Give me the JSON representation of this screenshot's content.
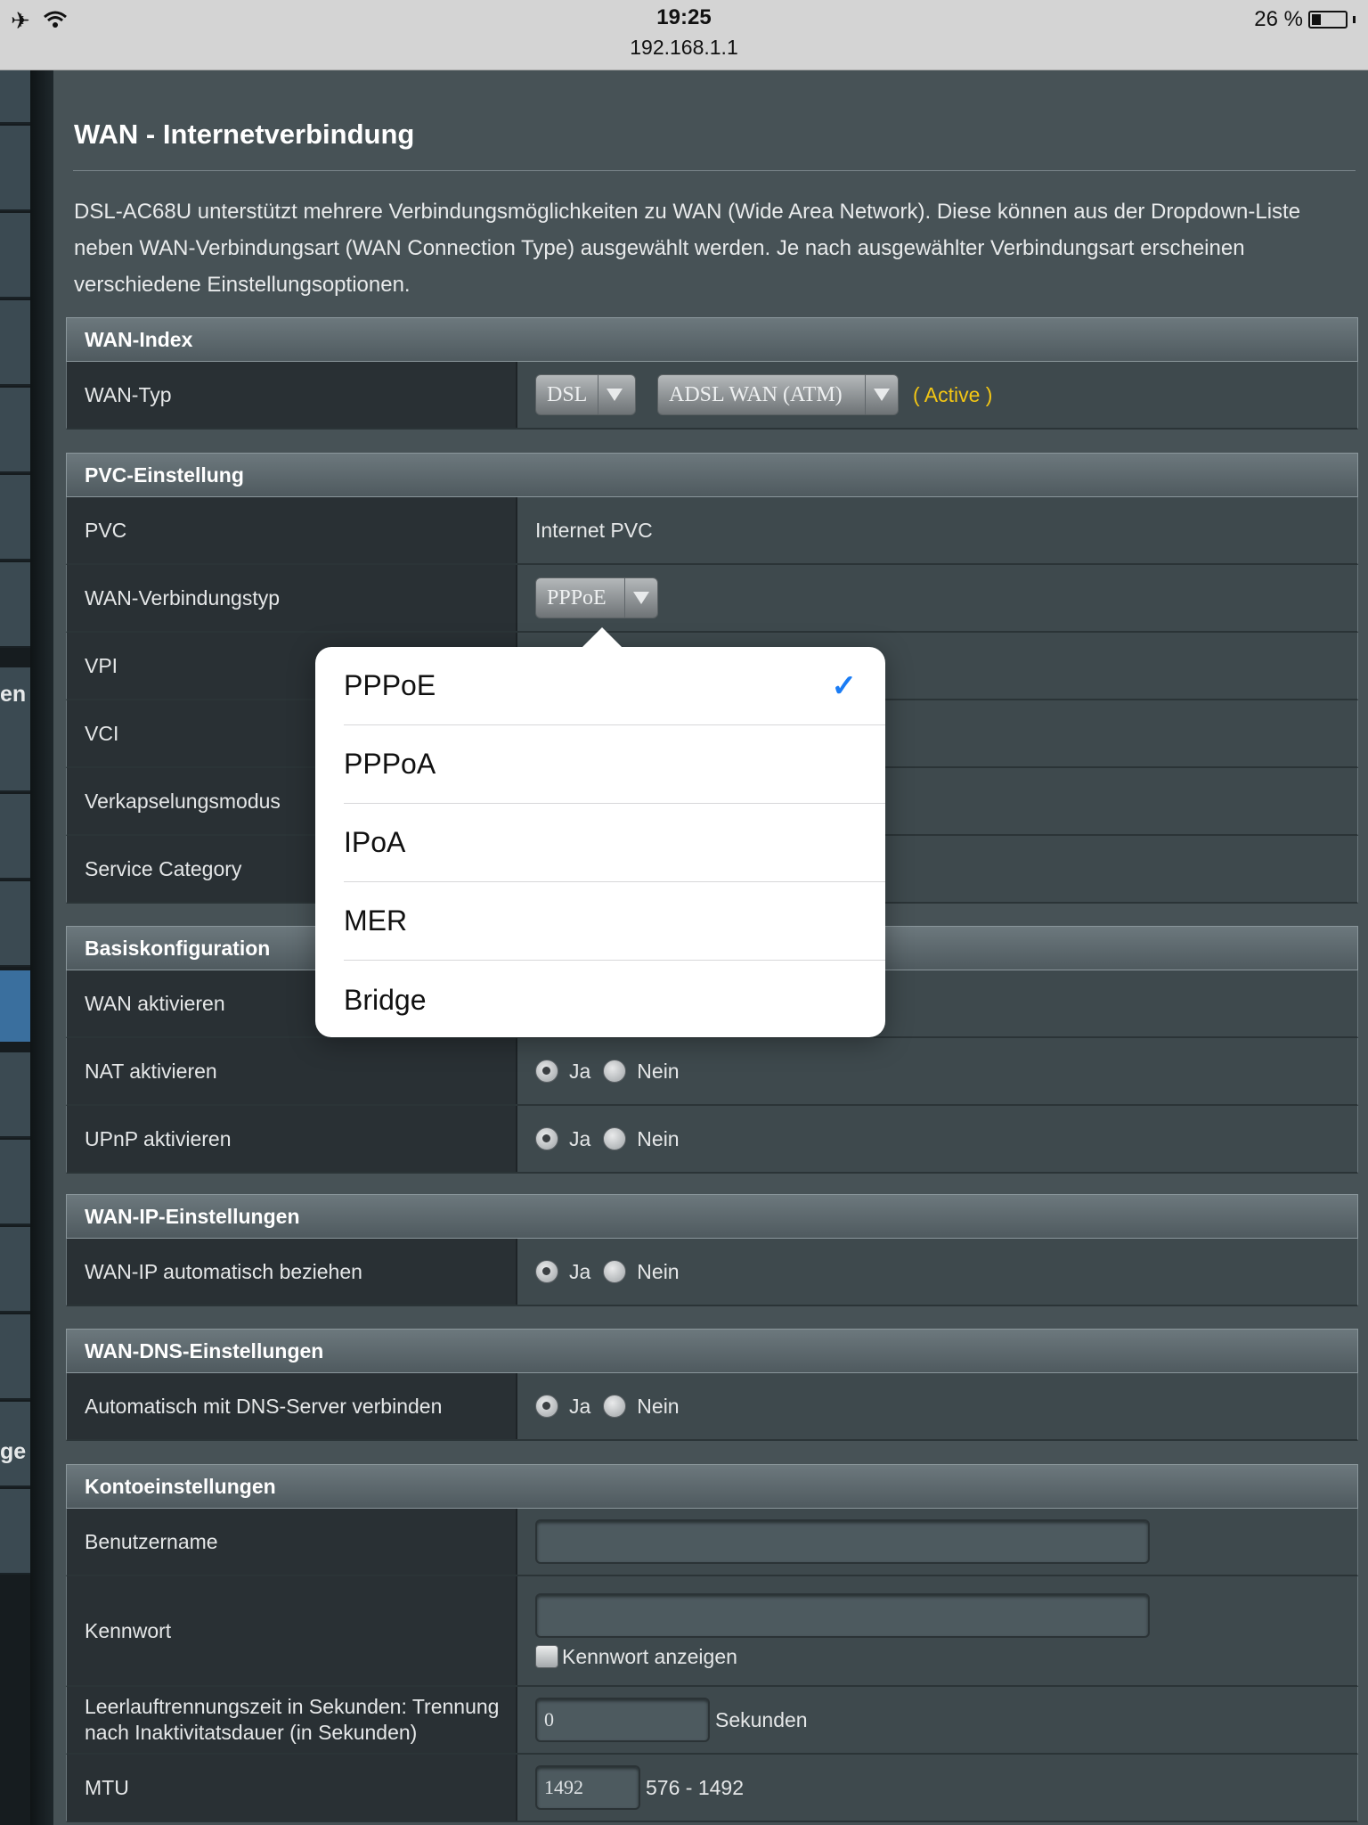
{
  "status": {
    "time": "19:25",
    "url": "192.168.1.1",
    "battery": "26 %"
  },
  "rail": {
    "label_1": "en",
    "label_2": "ge"
  },
  "page": {
    "title": "WAN - Internetverbindung",
    "description": "DSL-AC68U unterstützt mehrere Verbindungsmöglichkeiten zu WAN (Wide Area Network). Diese können aus der Dropdown-Liste neben WAN-Verbindungsart (WAN Connection Type) ausgewählt werden. Je nach ausgewählter Verbindungsart erscheinen verschiedene Einstellungsoptionen."
  },
  "wan_index": {
    "header": "WAN-Index",
    "wan_typ_label": "WAN-Typ",
    "wan_typ_value": "DSL",
    "wan_mode_value": "ADSL WAN (ATM)",
    "active_text": "( Active )"
  },
  "pvc": {
    "header": "PVC-Einstellung",
    "pvc_label": "PVC",
    "pvc_value": "Internet PVC",
    "conn_type_label": "WAN-Verbindungstyp",
    "conn_type_value": "PPPoE",
    "vpi_label": "VPI",
    "vci_label": "VCI",
    "encap_label": "Verkapselungsmodus",
    "service_label": "Service Category"
  },
  "basic": {
    "header": "Basiskonfiguration",
    "wan_enable_label": "WAN aktivieren",
    "nat_label": "NAT aktivieren",
    "upnp_label": "UPnP aktivieren"
  },
  "radio": {
    "yes": "Ja",
    "no": "Nein"
  },
  "wan_ip": {
    "header": "WAN-IP-Einstellungen",
    "auto_label": "WAN-IP automatisch beziehen"
  },
  "wan_dns": {
    "header": "WAN-DNS-Einstellungen",
    "auto_label": "Automatisch mit DNS-Server verbinden"
  },
  "account": {
    "header": "Kontoeinstellungen",
    "username_label": "Benutzername",
    "username_value": "",
    "password_label": "Kennwort",
    "password_value": "",
    "show_password": "Kennwort anzeigen",
    "idle_label": "Leerlauftrennungszeit in Sekunden: Trennung nach Inaktivitatsdauer (in Sekunden)",
    "idle_value": "0",
    "idle_unit": "Sekunden",
    "mtu_label": "MTU",
    "mtu_value": "1492",
    "mtu_range": "576 - 1492"
  },
  "popover": {
    "options": [
      "PPPoE",
      "PPPoA",
      "IPoA",
      "MER",
      "Bridge"
    ],
    "selected": "PPPoE",
    "check": "✓"
  }
}
